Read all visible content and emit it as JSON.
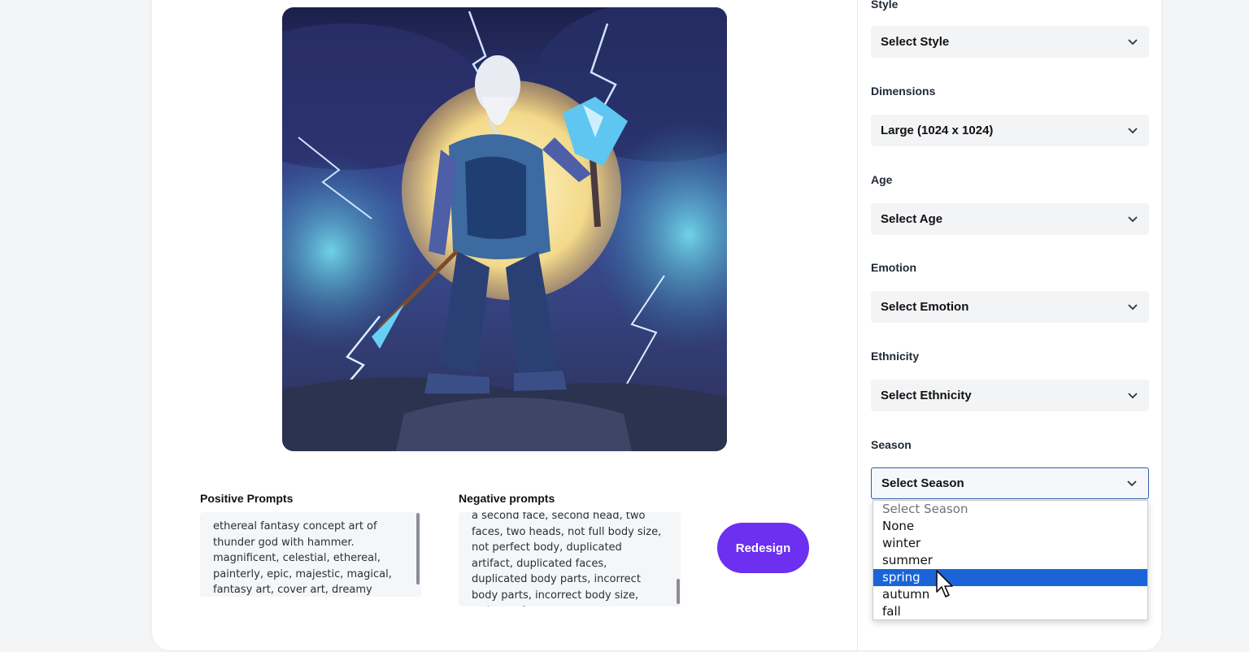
{
  "image": {
    "alt": "thunder god with hammer"
  },
  "prompts": {
    "positive_label": "Positive Prompts",
    "positive_text": "ethereal fantasy concept art of thunder god with hammer. magnificent, celestial, ethereal, painterly, epic, majestic, magical, fantasy art, cover art, dreamy",
    "negative_label": "Negative prompts",
    "negative_text": "a second face, second head, two faces, two heads, not full body size, not perfect body, duplicated artifact, duplicated faces, duplicated body parts, incorrect body parts, incorrect body size, watermark"
  },
  "redesign_label": "Redesign",
  "fields": {
    "style": {
      "label": "Style",
      "value": "Select Style"
    },
    "dimensions": {
      "label": "Dimensions",
      "value": "Large (1024 x 1024)"
    },
    "age": {
      "label": "Age",
      "value": "Select Age"
    },
    "emotion": {
      "label": "Emotion",
      "value": "Select Emotion"
    },
    "ethnicity": {
      "label": "Ethnicity",
      "value": "Select Ethnicity"
    },
    "season": {
      "label": "Season",
      "value": "Select Season"
    }
  },
  "season_options": [
    "Select Season",
    "None",
    "winter",
    "summer",
    "spring",
    "autumn",
    "fall"
  ],
  "season_highlighted": "spring",
  "colors": {
    "accent": "#6d2ff0",
    "highlight": "#1a64d8",
    "focus_border": "#2c5dab"
  },
  "icons": {
    "chevron": "chevron-down-icon",
    "cursor": "mouse-pointer-icon"
  }
}
